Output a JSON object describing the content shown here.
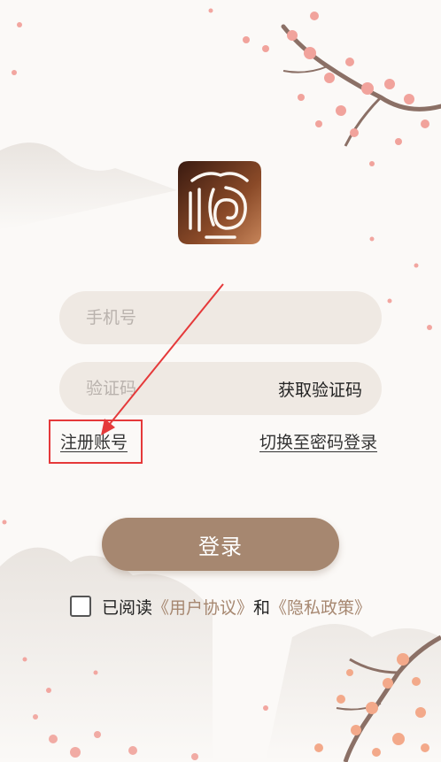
{
  "phone_field": {
    "placeholder": "手机号"
  },
  "code_field": {
    "placeholder": "验证码",
    "get_code_label": "获取验证码"
  },
  "links": {
    "register": "注册账号",
    "switch_password": "切换至密码登录"
  },
  "login_button": {
    "label": "登录"
  },
  "agreement": {
    "prefix": "已阅读",
    "user_agreement": "《用户协议》",
    "connector": "和",
    "privacy_policy": "《隐私政策》",
    "checked": false
  },
  "colors": {
    "accent": "#a68770",
    "field_bg": "#efe9e3",
    "annotation_red": "#e5393a",
    "logo_dark": "#3a1a10",
    "logo_light": "#c7855a"
  },
  "icons": {
    "logo": "seal-logo-icon",
    "checkbox": "checkbox-icon"
  }
}
